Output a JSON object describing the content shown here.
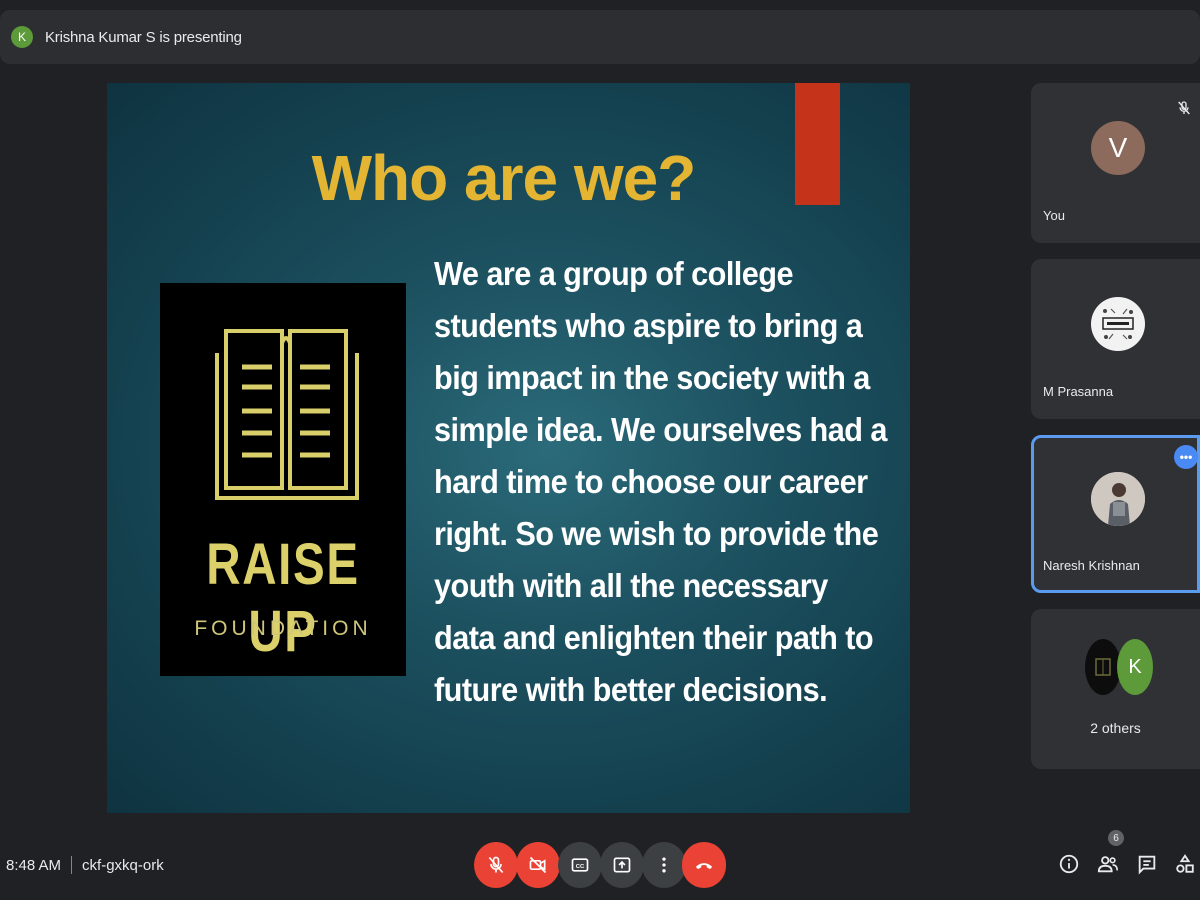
{
  "presenting": {
    "avatar_letter": "K",
    "text": "Krishna Kumar S is presenting"
  },
  "slide": {
    "title": "Who are we?",
    "body": "We are a group of college students who aspire to bring a big impact in the society with a simple idea. We ourselves had a hard time to choose our career right. So we wish to provide the youth with all the necessary data and enlighten their path to future with better decisions.",
    "logo_name": "RAISE UP",
    "logo_subtitle": "FOUNDATION",
    "colors": {
      "title": "#e3b533",
      "accent": "#c5341a",
      "logo": "#dbd06a"
    }
  },
  "participants": {
    "you": {
      "name": "You",
      "avatar_letter": "V",
      "status_icon": "mic-off-icon"
    },
    "prasanna": {
      "name": "M Prasanna",
      "avatar_icon": "science-logo-avatar"
    },
    "naresh": {
      "name": "Naresh Krishnan",
      "avatar_icon": "photo-avatar",
      "menu_icon": "more-options-icon"
    },
    "others": {
      "label": "2 others",
      "avatar_letter": "K"
    }
  },
  "bottom_bar": {
    "time": "8:48 AM",
    "meeting_code": "ckf-gxkq-ork",
    "controls": [
      {
        "name": "microphone-off",
        "icon": "mic-off-icon"
      },
      {
        "name": "camera-off",
        "icon": "camera-off-icon"
      },
      {
        "name": "captions",
        "icon": "captions-icon"
      },
      {
        "name": "present-now",
        "icon": "present-icon"
      },
      {
        "name": "more-options",
        "icon": "more-vert-icon"
      },
      {
        "name": "leave-call",
        "icon": "hang-up-icon"
      }
    ],
    "people_count": "6",
    "right_icons": [
      "info-icon",
      "people-icon",
      "chat-icon",
      "activities-icon"
    ]
  }
}
